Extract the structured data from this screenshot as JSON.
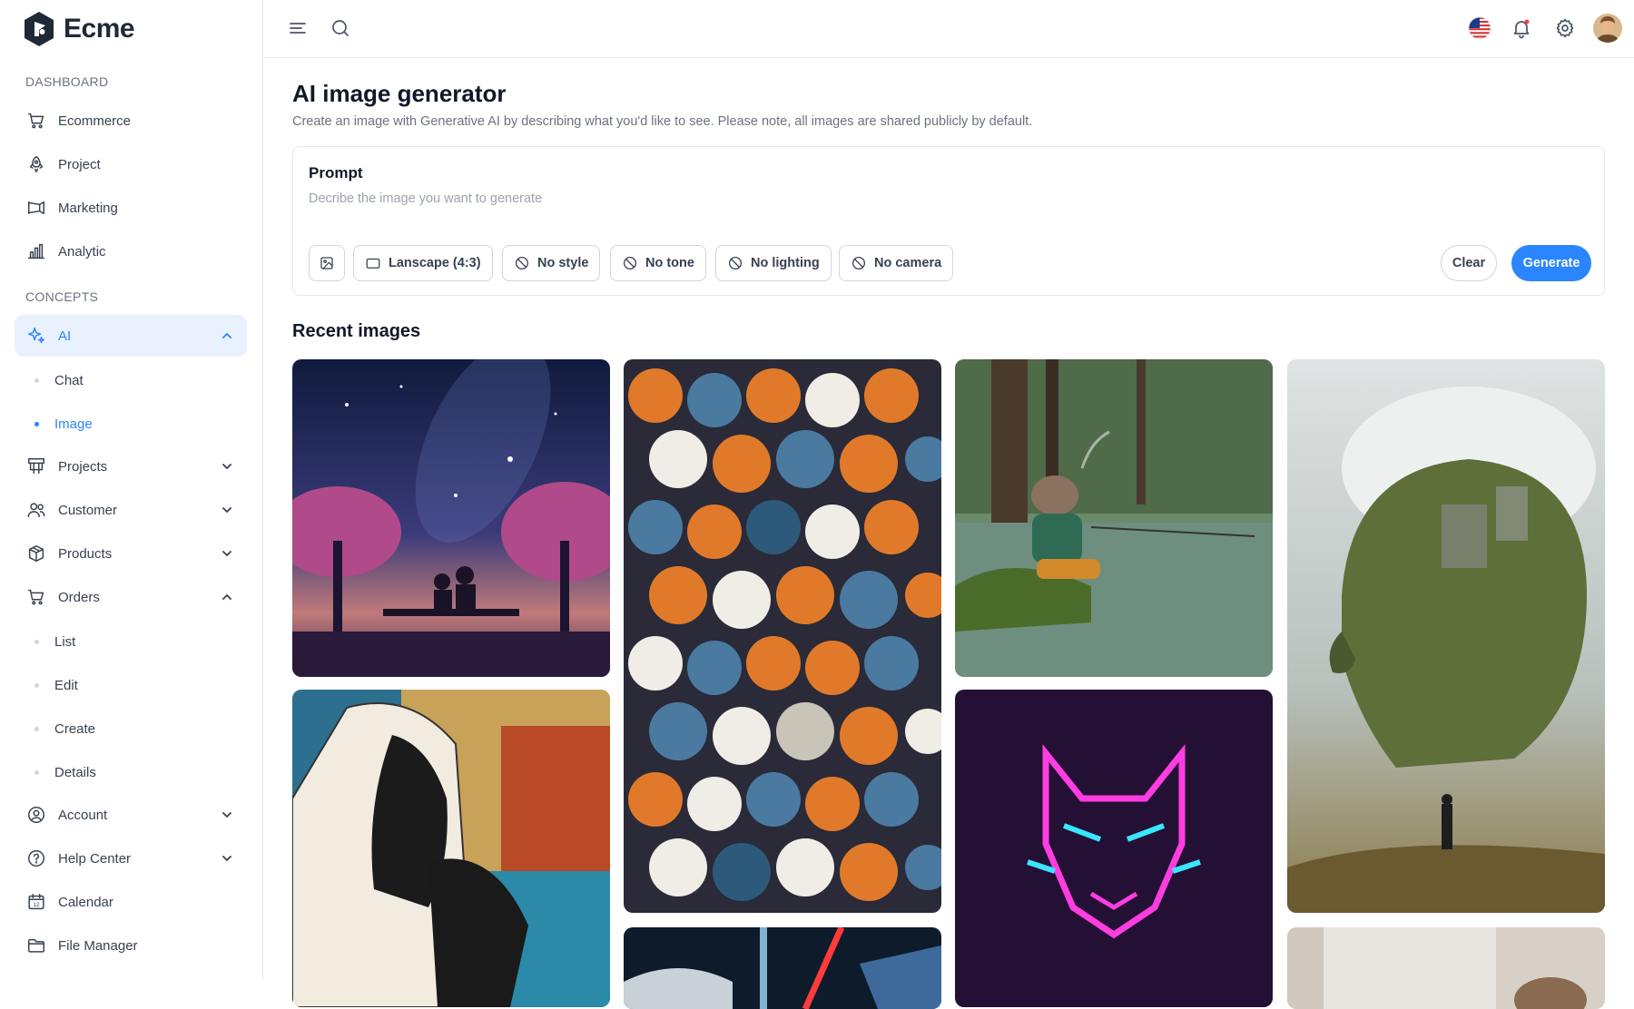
{
  "app": {
    "name": "Ecme"
  },
  "sidebar": {
    "sections": [
      {
        "label": "DASHBOARD"
      },
      {
        "label": "CONCEPTS"
      }
    ],
    "items": [
      {
        "label": "Ecommerce",
        "icon": "cart-icon"
      },
      {
        "label": "Project",
        "icon": "rocket-icon"
      },
      {
        "label": "Marketing",
        "icon": "megaphone-icon"
      },
      {
        "label": "Analytic",
        "icon": "bar-chart-icon"
      },
      {
        "label": "AI",
        "icon": "sparkle-icon",
        "expanded": true,
        "active": true
      },
      {
        "label": "Projects",
        "icon": "kanban-icon",
        "expanded": false
      },
      {
        "label": "Customer",
        "icon": "users-icon",
        "expanded": false
      },
      {
        "label": "Products",
        "icon": "box-icon",
        "expanded": false
      },
      {
        "label": "Orders",
        "icon": "cart-icon",
        "expanded": true
      },
      {
        "label": "Account",
        "icon": "user-circle-icon",
        "expanded": false
      },
      {
        "label": "Help Center",
        "icon": "help-icon",
        "expanded": false
      },
      {
        "label": "Calendar",
        "icon": "calendar-icon"
      },
      {
        "label": "File Manager",
        "icon": "folder-icon"
      }
    ],
    "ai_sub": [
      {
        "label": "Chat",
        "active": false
      },
      {
        "label": "Image",
        "active": true
      }
    ],
    "orders_sub": [
      {
        "label": "List"
      },
      {
        "label": "Edit"
      },
      {
        "label": "Create"
      },
      {
        "label": "Details"
      }
    ],
    "calendar_day": "12"
  },
  "topbar": {
    "icons": [
      "menu-icon",
      "search-icon",
      "us-flag-icon",
      "bell-icon",
      "gear-icon",
      "avatar"
    ]
  },
  "main": {
    "title": "AI image generator",
    "subtitle": "Create an image with Generative AI by describing what you'd like to see. Please note, all images are shared publicly by default.",
    "prompt": {
      "label": "Prompt",
      "placeholder": "Decribe the image you want to generate",
      "value": ""
    },
    "options": [
      {
        "label": "Lanscape (4:3)",
        "icon": "landscape-icon"
      },
      {
        "label": "No style",
        "icon": "ban-icon"
      },
      {
        "label": "No tone",
        "icon": "ban-icon"
      },
      {
        "label": "No lighting",
        "icon": "ban-icon"
      },
      {
        "label": "No camera",
        "icon": "ban-icon"
      }
    ],
    "clear_label": "Clear",
    "generate_label": "Generate",
    "recent_title": "Recent images"
  },
  "colors": {
    "accent": "#2a85ff",
    "active_bg": "#e8f1fd",
    "border": "#e5e7eb",
    "text": "#374151",
    "muted": "#6b7280"
  }
}
